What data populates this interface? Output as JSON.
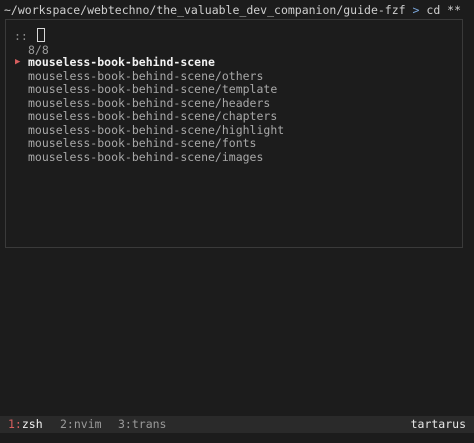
{
  "prompt": {
    "path": "~/workspace/webtechno/the_valuable_dev_companion/guide-fzf",
    "arrow": ">",
    "command": "cd **"
  },
  "fzf": {
    "query_prompt": "::",
    "match_count": "8/8",
    "pointer": "▶",
    "results": [
      "mouseless-book-behind-scene",
      "mouseless-book-behind-scene/others",
      "mouseless-book-behind-scene/template",
      "mouseless-book-behind-scene/headers",
      "mouseless-book-behind-scene/chapters",
      "mouseless-book-behind-scene/highlight",
      "mouseless-book-behind-scene/fonts",
      "mouseless-book-behind-scene/images"
    ]
  },
  "tmux": {
    "windows": [
      {
        "num": "1:",
        "name": "zsh"
      },
      {
        "num": "2:",
        "name": "nvim"
      },
      {
        "num": "3:",
        "name": "trans"
      }
    ],
    "hostname": "tartarus"
  },
  "colors": {
    "background": "#1c1c1c",
    "pointer": "#d75f5f",
    "prompt_arrow": "#7aa6da",
    "statusbar": "#2a2a2a"
  }
}
